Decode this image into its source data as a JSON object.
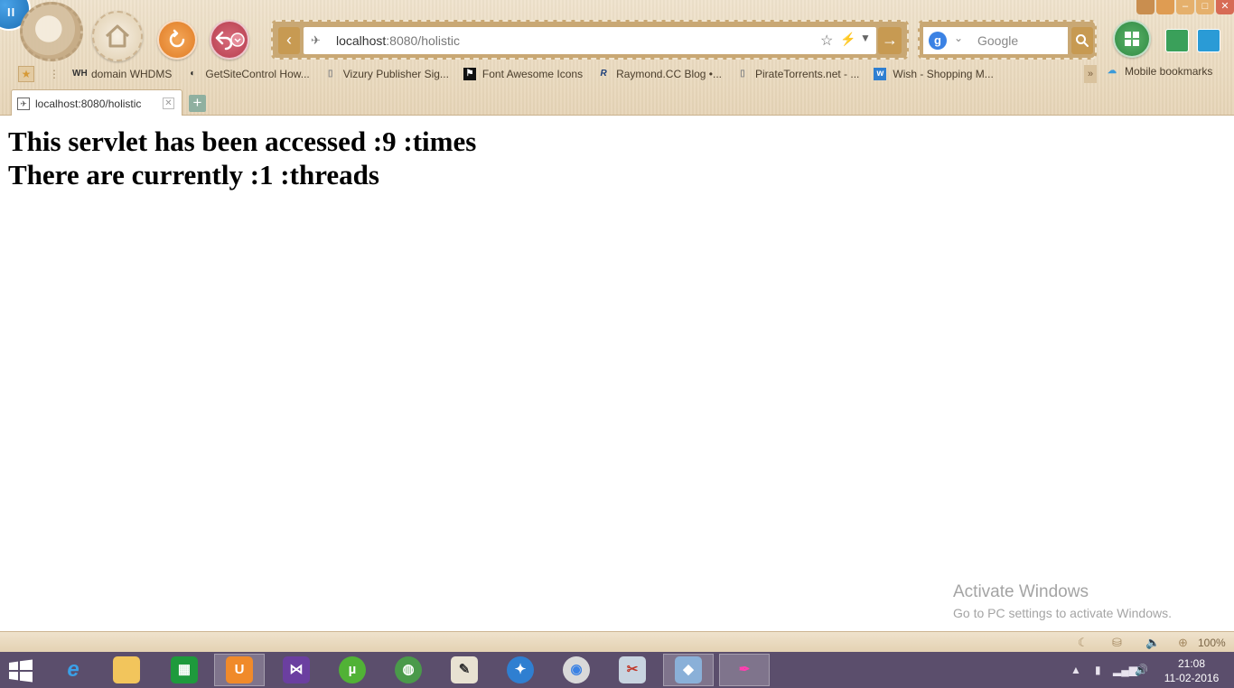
{
  "browser": {
    "address": {
      "host": "localhost",
      "rest": ":8080/holistic"
    },
    "search": {
      "engine": "g",
      "placeholder": "Google"
    },
    "bookmarks": [
      {
        "icon": "WH",
        "label": "domain WHDMS"
      },
      {
        "icon": "◐",
        "label": "GetSiteControl How..."
      },
      {
        "icon": "▯",
        "label": "Vizury Publisher Sig..."
      },
      {
        "icon": "⚑",
        "label": "Font Awesome Icons"
      },
      {
        "icon": "R",
        "label": "Raymond.CC Blog •..."
      },
      {
        "icon": "▯",
        "label": "PirateTorrents.net - ..."
      },
      {
        "icon": "w",
        "label": "Wish - Shopping M..."
      }
    ],
    "mobile_bookmarks": "Mobile bookmarks",
    "tab": {
      "title": "localhost:8080/holistic"
    },
    "zoom": "100%"
  },
  "page": {
    "line1": "This servlet has been accessed :9 :times",
    "line2": "There are currently :1 :threads"
  },
  "watermark": {
    "title": "Activate Windows",
    "subtitle": "Go to PC settings to activate Windows."
  },
  "taskbar": {
    "time": "21:08",
    "date": "11-02-2016"
  }
}
